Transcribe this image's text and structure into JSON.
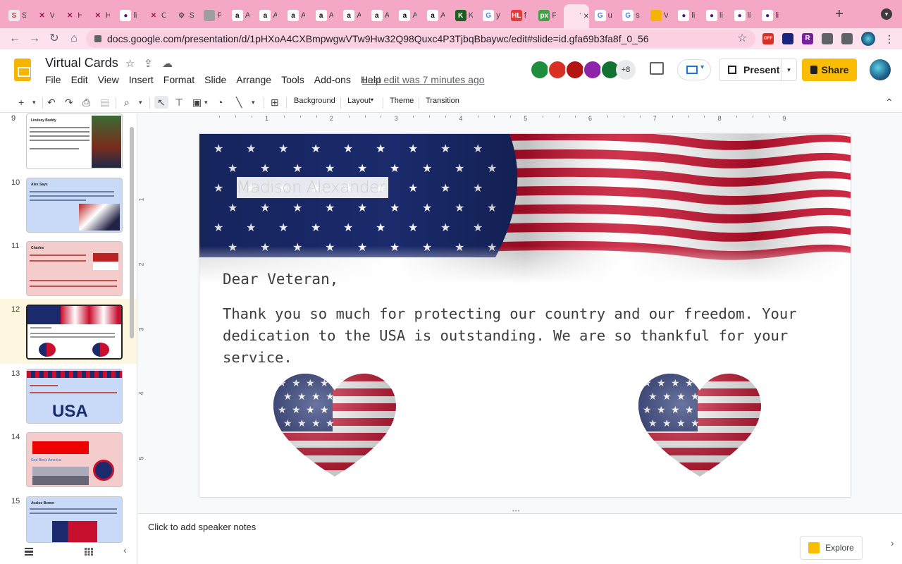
{
  "browser": {
    "tabs": [
      {
        "label": "S",
        "fav": "S",
        "color": "#e8eaed",
        "fg": "#d33"
      },
      {
        "label": "V",
        "fav": "✕",
        "color": "#f5a8c6",
        "fg": "#a0174e"
      },
      {
        "label": "H",
        "fav": "✕",
        "color": "#f5a8c6",
        "fg": "#a0174e"
      },
      {
        "label": "H",
        "fav": "✕",
        "color": "#f5a8c6",
        "fg": "#a0174e"
      },
      {
        "label": "li",
        "fav": "●",
        "color": "#fff",
        "fg": "#4a148c"
      },
      {
        "label": "C",
        "fav": "✕",
        "color": "#f5a8c6",
        "fg": "#a0174e"
      },
      {
        "label": "S",
        "fav": "⚙",
        "color": "#f5a8c6",
        "fg": "#555"
      },
      {
        "label": "F",
        "fav": "",
        "color": "#9e9e9e",
        "fg": "#fff"
      },
      {
        "label": "A",
        "fav": "a",
        "color": "#fff",
        "fg": "#000"
      },
      {
        "label": "A",
        "fav": "a",
        "color": "#fff",
        "fg": "#000"
      },
      {
        "label": "A",
        "fav": "a",
        "color": "#fff",
        "fg": "#000"
      },
      {
        "label": "A",
        "fav": "a",
        "color": "#fff",
        "fg": "#000"
      },
      {
        "label": "A",
        "fav": "a",
        "color": "#fff",
        "fg": "#000"
      },
      {
        "label": "A",
        "fav": "a",
        "color": "#fff",
        "fg": "#000"
      },
      {
        "label": "A",
        "fav": "a",
        "color": "#fff",
        "fg": "#000"
      },
      {
        "label": "A",
        "fav": "a",
        "color": "#fff",
        "fg": "#000"
      },
      {
        "label": "K",
        "fav": "K",
        "color": "#1b5e20",
        "fg": "#fff"
      },
      {
        "label": "y",
        "fav": "G",
        "color": "#fff",
        "fg": "#4285f4"
      },
      {
        "label": "f",
        "fav": "HL",
        "color": "#e53935",
        "fg": "#fff"
      },
      {
        "label": "F",
        "fav": "px",
        "color": "#43a047",
        "fg": "#fff"
      },
      {
        "label": "V",
        "fav": "",
        "color": "#fde1ec",
        "fg": "#202124"
      },
      {
        "label": "u",
        "fav": "G",
        "color": "#fff",
        "fg": "#4285f4"
      },
      {
        "label": "s",
        "fav": "G",
        "color": "#fff",
        "fg": "#4285f4"
      },
      {
        "label": "V",
        "fav": "",
        "color": "#f4b400",
        "fg": "#fff"
      },
      {
        "label": "li",
        "fav": "●",
        "color": "#fff",
        "fg": "#4a148c"
      },
      {
        "label": "li",
        "fav": "●",
        "color": "#fff",
        "fg": "#4a148c"
      },
      {
        "label": "li",
        "fav": "●",
        "color": "#fff",
        "fg": "#4a148c"
      },
      {
        "label": "li",
        "fav": "●",
        "color": "#fff",
        "fg": "#4a148c"
      }
    ],
    "url": "docs.google.com/presentation/d/1pHXoA4CXBmpwgwVTw9Hw32Q98Quxc4P3TjbqBbaywc/edit#slide=id.gfa69b3fa8f_0_56",
    "new_tab": "+",
    "ext_labels": [
      "OFF",
      "",
      "R",
      "",
      "",
      ""
    ]
  },
  "docs": {
    "title": "Virtual Cards",
    "menus": [
      "File",
      "Edit",
      "View",
      "Insert",
      "Format",
      "Slide",
      "Arrange",
      "Tools",
      "Add-ons",
      "Help"
    ],
    "last_edit": "Last edit was 7 minutes ago",
    "more_collaborators": "+8",
    "present_label": "Present",
    "share_label": "Share"
  },
  "toolbar": {
    "background": "Background",
    "layout": "Layout",
    "theme": "Theme",
    "transition": "Transition"
  },
  "ruler": {
    "h_numbers": [
      "1",
      "2",
      "3",
      "4",
      "5",
      "6",
      "7",
      "8",
      "9"
    ],
    "v_numbers": [
      "1",
      "2",
      "3",
      "4",
      "5"
    ]
  },
  "filmstrip": {
    "slides": [
      {
        "num": "9",
        "title": "Lindsey Buddy"
      },
      {
        "num": "10",
        "title": "Alex Says"
      },
      {
        "num": "11",
        "title": "Charles"
      },
      {
        "num": "12",
        "title": ""
      },
      {
        "num": "13",
        "title": ""
      },
      {
        "num": "14",
        "title": "God Bless America"
      },
      {
        "num": "15",
        "title": "Avalos Bemer"
      }
    ]
  },
  "slide": {
    "name_placeholder": "Madison Alexander",
    "greeting": "Dear Veteran,",
    "message": "Thank you so much for protecting our country and our freedom. Your dedication to the USA is outstanding. We are so thankful for your service."
  },
  "notes": {
    "placeholder": "Click to add speaker notes"
  },
  "explore": {
    "label": "Explore"
  },
  "colors": {
    "share": "#fbbc04",
    "tabstrip": "#f5a8c6",
    "flag_red": "#c8102e",
    "flag_blue": "#1a2a6c"
  }
}
